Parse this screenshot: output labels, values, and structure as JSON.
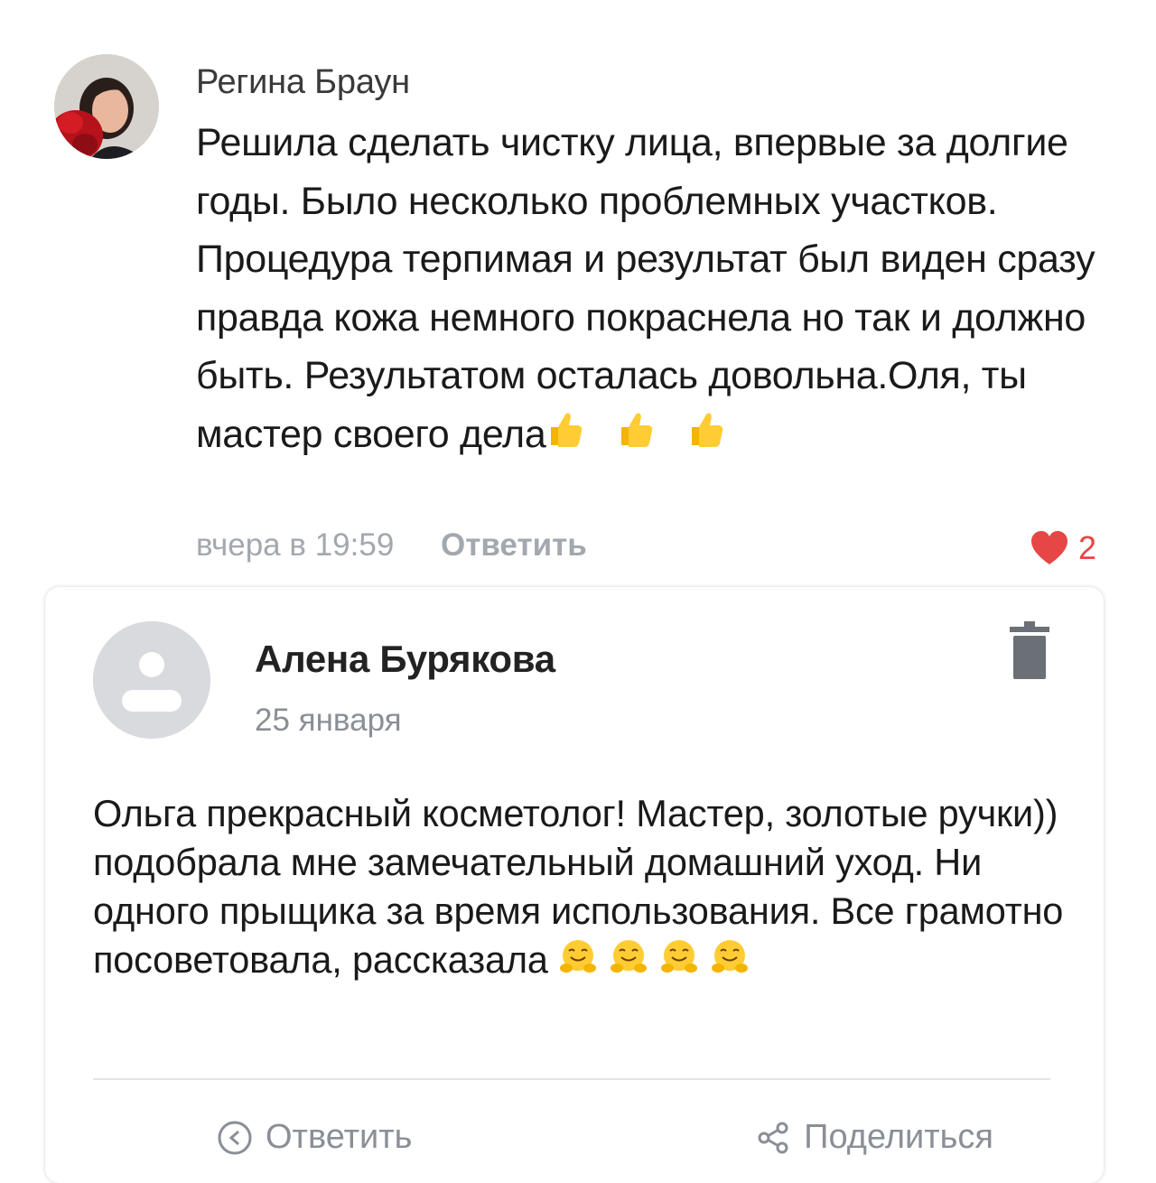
{
  "comment1": {
    "author": "Регина Браун",
    "text_before_emoji": "Решила сделать чистку лица, впервые за долгие годы. Было несколько проблемных участков. Процедура терпимая и результат был виден сразу правда кожа немного покраснела но так и должно быть. Результатом осталась довольна.Оля, ты мастер своего дела",
    "emojis": [
      "thumbs-up",
      "thumbs-up",
      "thumbs-up"
    ],
    "time": "вчера в 19:59",
    "reply_label": "Ответить",
    "likes_count": "2",
    "like_color": "#e64646"
  },
  "comment2": {
    "author": "Алена Бурякова",
    "date": "25 января",
    "text_before_emoji": "Ольга прекрасный косметолог! Мастер, золотые ручки)) подобрала мне замечательный домашний уход.  Ни одного прыщика за время использования. Все грамотно посоветовала, рассказала",
    "emojis": [
      "hugging-face",
      "hugging-face",
      "hugging-face",
      "hugging-face"
    ],
    "actions": [
      {
        "label": "Ответить",
        "icon": "reply-icon"
      },
      {
        "label": "Поделиться",
        "icon": "share-icon"
      }
    ]
  }
}
